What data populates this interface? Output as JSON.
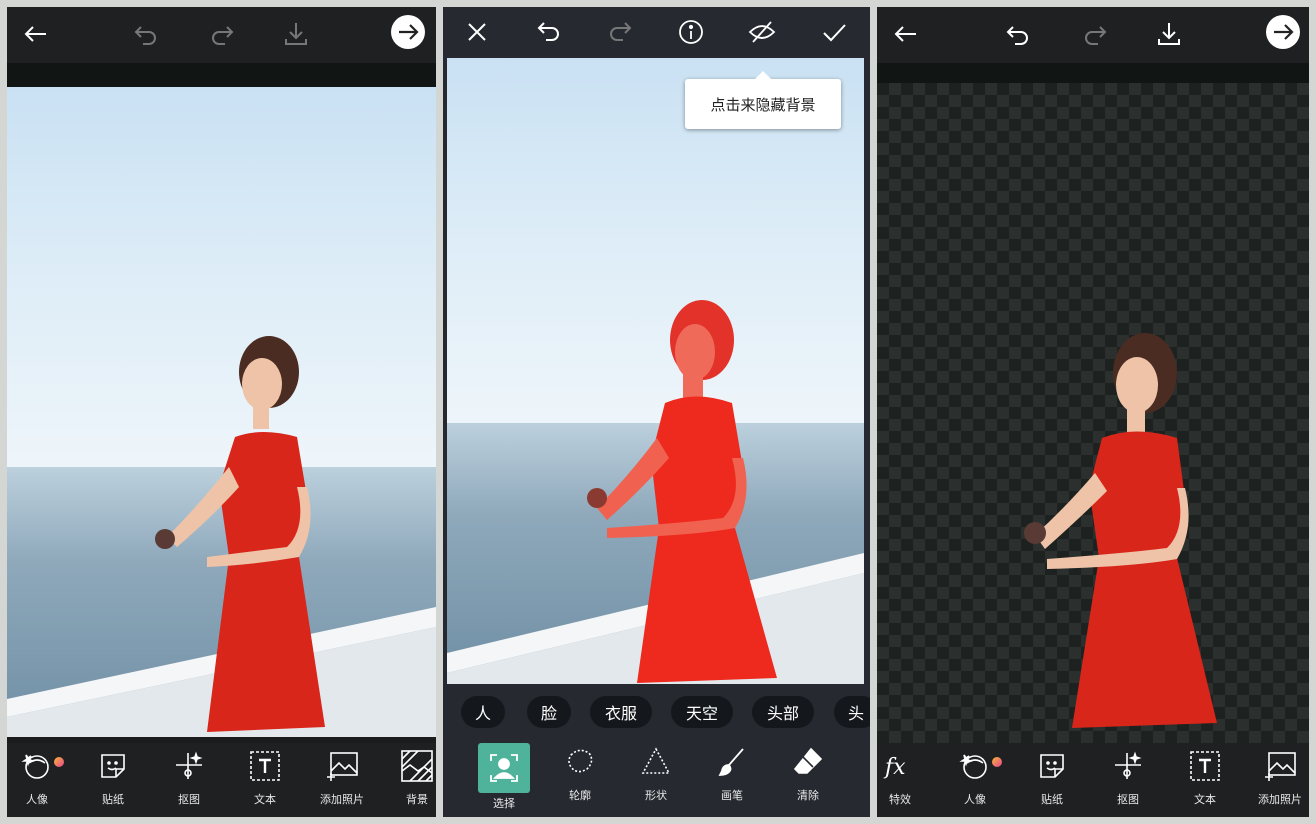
{
  "panel1": {
    "toolbar_icons": [
      "back-arrow-icon",
      "undo-icon",
      "redo-icon",
      "download-icon",
      "next-arrow-icon"
    ],
    "tools": [
      {
        "label": "人像",
        "icon": "portrait-icon"
      },
      {
        "label": "贴纸",
        "icon": "sticker-icon"
      },
      {
        "label": "抠图",
        "icon": "cutout-icon"
      },
      {
        "label": "文本",
        "icon": "text-icon"
      },
      {
        "label": "添加照片",
        "icon": "add-photo-icon"
      },
      {
        "label": "背景",
        "icon": "background-icon"
      }
    ]
  },
  "panel2": {
    "toolbar_icons": [
      "close-icon",
      "undo-icon",
      "redo-icon",
      "info-icon",
      "hide-eye-icon",
      "check-icon"
    ],
    "tooltip": "点击来隐藏背景",
    "chips": [
      "人",
      "脸",
      "衣服",
      "天空",
      "头部",
      "头"
    ],
    "tools": [
      {
        "label": "选择",
        "icon": "select-person-icon",
        "active": true
      },
      {
        "label": "轮廓",
        "icon": "lasso-icon"
      },
      {
        "label": "形状",
        "icon": "shape-icon"
      },
      {
        "label": "画笔",
        "icon": "brush-icon"
      },
      {
        "label": "清除",
        "icon": "eraser-icon"
      }
    ]
  },
  "panel3": {
    "toolbar_icons": [
      "back-arrow-icon",
      "undo-icon",
      "redo-icon",
      "download-icon",
      "next-arrow-icon"
    ],
    "tools": [
      {
        "label": "特效",
        "icon": "fx-icon"
      },
      {
        "label": "人像",
        "icon": "portrait-icon"
      },
      {
        "label": "贴纸",
        "icon": "sticker-icon"
      },
      {
        "label": "抠图",
        "icon": "cutout-icon"
      },
      {
        "label": "文本",
        "icon": "text-icon"
      },
      {
        "label": "添加照片",
        "icon": "add-photo-icon"
      }
    ]
  },
  "colors": {
    "accent": "#4fb39b",
    "dress": "#d8261b",
    "selection_overlay": "#ff3b30",
    "toolbar_bg": "#1f2021"
  }
}
